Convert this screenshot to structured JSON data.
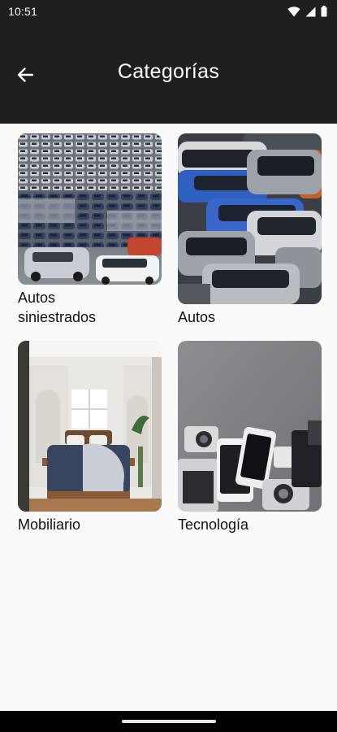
{
  "status_bar": {
    "time": "10:51",
    "icons": [
      "wifi-icon",
      "signal-icon",
      "battery-icon"
    ]
  },
  "app_bar": {
    "title": "Categorías",
    "back_icon": "arrow-back-icon"
  },
  "categories": [
    {
      "label": "Autos\nsiniestrados",
      "image": "parking-lot-cars-image"
    },
    {
      "label": "Autos",
      "image": "rows-of-cars-image"
    },
    {
      "label": "Mobiliario",
      "image": "bedroom-furniture-image"
    },
    {
      "label": "Tecnología",
      "image": "gadgets-devices-image"
    }
  ],
  "colors": {
    "app_bar_bg": "#1f1f1f",
    "page_bg": "#fafafa",
    "text": "#111111"
  }
}
